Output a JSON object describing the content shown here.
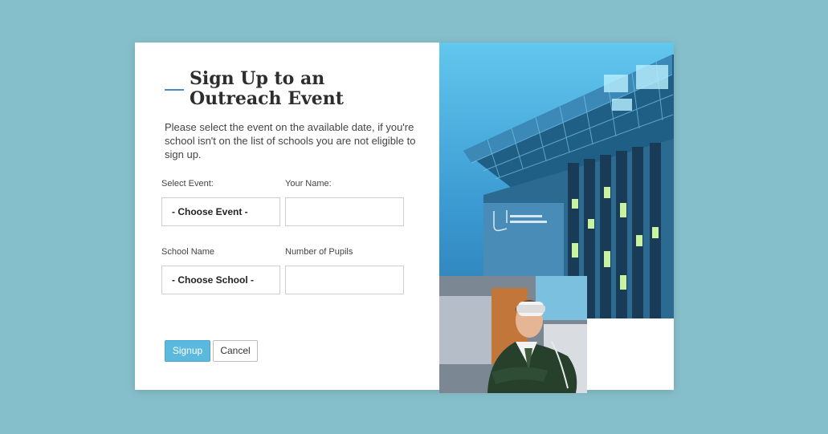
{
  "title": "Sign Up to an Outreach Event",
  "intro": "Please select the event on the available date, if you're school isn't on the list of schools you are not eligible to sign up.",
  "fields": {
    "event_label": "Select Event:",
    "event_value": "- Choose Event -",
    "name_label": "Your Name:",
    "name_value": "",
    "school_label": "School Name",
    "school_value": "- Choose School -",
    "pupils_label": "Number of Pupils",
    "pupils_value": ""
  },
  "buttons": {
    "signup": "Signup",
    "cancel": "Cancel"
  },
  "colors": {
    "background": "#86bfcc",
    "accent": "#5bb9de",
    "title_dash": "#4b86c6"
  }
}
